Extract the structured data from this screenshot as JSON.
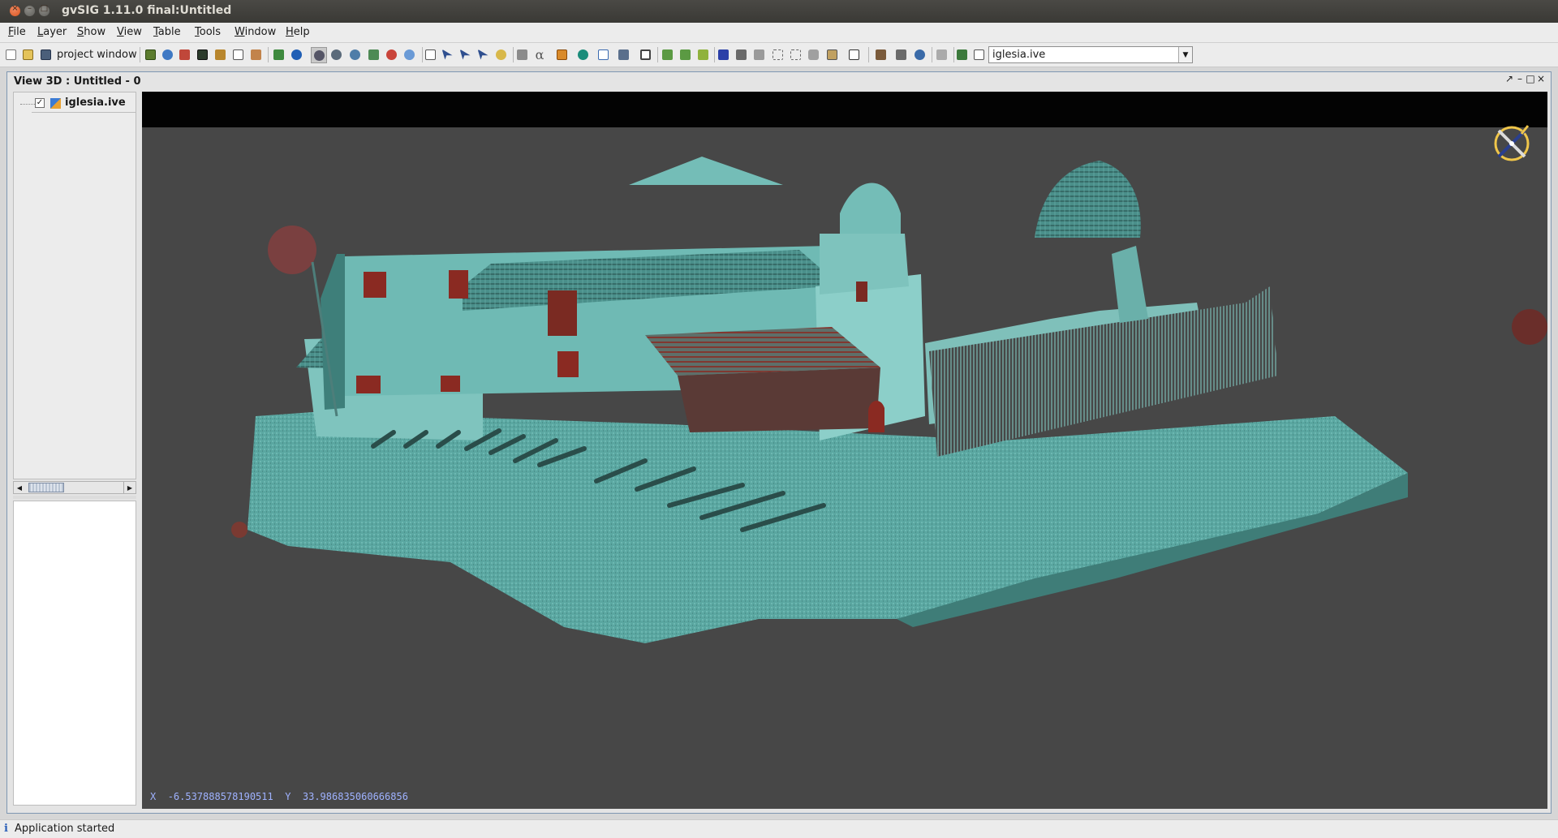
{
  "window": {
    "title": "gvSIG 1.11.0 final:Untitled",
    "close_glyph": "×",
    "min_glyph": "–",
    "max_glyph": "□"
  },
  "menu": [
    {
      "key": "F",
      "rest": "ile"
    },
    {
      "key": "L",
      "rest": "ayer"
    },
    {
      "key": "S",
      "rest": "how"
    },
    {
      "key": "V",
      "rest": "iew"
    },
    {
      "key": "T",
      "rest": "able"
    },
    {
      "key": "T",
      "rest": "ools"
    },
    {
      "key": "W",
      "rest": "indow"
    },
    {
      "key": "H",
      "rest": "elp"
    }
  ],
  "toolbar": {
    "project_window_label": "project window",
    "layer_combo_value": "iglesia.ive",
    "combo_arrow": "▼"
  },
  "view": {
    "title": "View 3D : Untitled - 0",
    "ctrl_restore": "↗",
    "ctrl_minimize": "–",
    "ctrl_maximize": "□",
    "ctrl_close": "×"
  },
  "toc": {
    "layer_name": "iglesia.ive",
    "layer_checked": "✓",
    "scroll_left": "◀",
    "scroll_right": "▶"
  },
  "coordinates": {
    "x_label": "X",
    "x_value": "-6.537888578190511",
    "y_label": "Y",
    "y_value": "33.986835060666856"
  },
  "status": {
    "icon": "i",
    "message": "Application started"
  },
  "colors": {
    "cloud_cyan": "#4fb3ad",
    "cloud_red": "#8a2a22",
    "canvas_bg": "#474747",
    "coords_text": "#9fb2ff"
  }
}
